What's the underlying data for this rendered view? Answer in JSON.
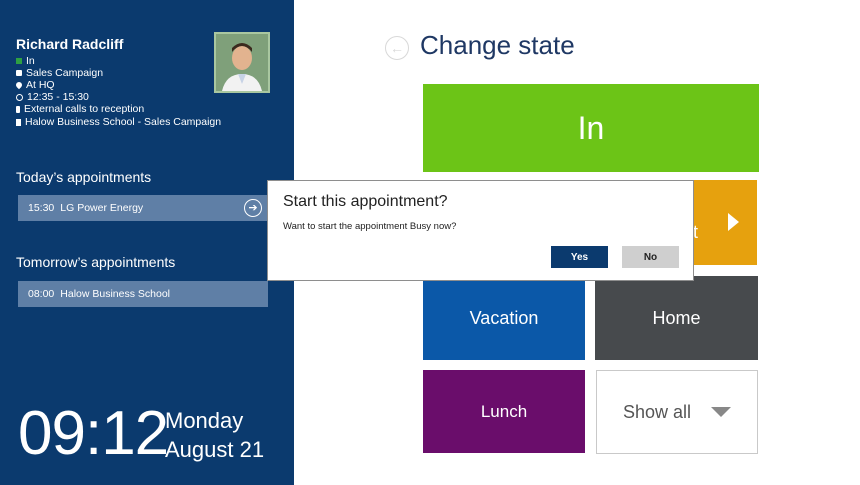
{
  "user": {
    "name": "Richard Radcliff",
    "status": "In",
    "campaign": "Sales Campaign",
    "location": "At HQ",
    "time_range": "12:35 - 15:30",
    "calls": "External calls to reception",
    "school": "Halow Business School - Sales Campaign"
  },
  "today": {
    "title": "Today’s appointments",
    "items": [
      {
        "time": "15:30",
        "name": "LG Power Energy"
      }
    ]
  },
  "tomorrow": {
    "title": "Tomorrow’s appointments",
    "items": [
      {
        "time": "08:00",
        "name": "Halow Business School"
      }
    ]
  },
  "clock": {
    "time": "09:12",
    "day": "Monday",
    "date": "August 21"
  },
  "page": {
    "title": "Change state"
  },
  "tiles": {
    "in": "In",
    "appointment": "ent",
    "vacation": "Vacation",
    "home": "Home",
    "lunch": "Lunch",
    "show_all": "Show all"
  },
  "dialog": {
    "title": "Start this appointment?",
    "message": "Want to start the appointment Busy now?",
    "yes": "Yes",
    "no": "No"
  },
  "colors": {
    "sidebar": "#0b3a6e",
    "tile_in": "#6cc417",
    "tile_appointment": "#e6a10e",
    "tile_vacation": "#0b58a8",
    "tile_home": "#474a4d",
    "tile_lunch": "#6a0d6b"
  }
}
